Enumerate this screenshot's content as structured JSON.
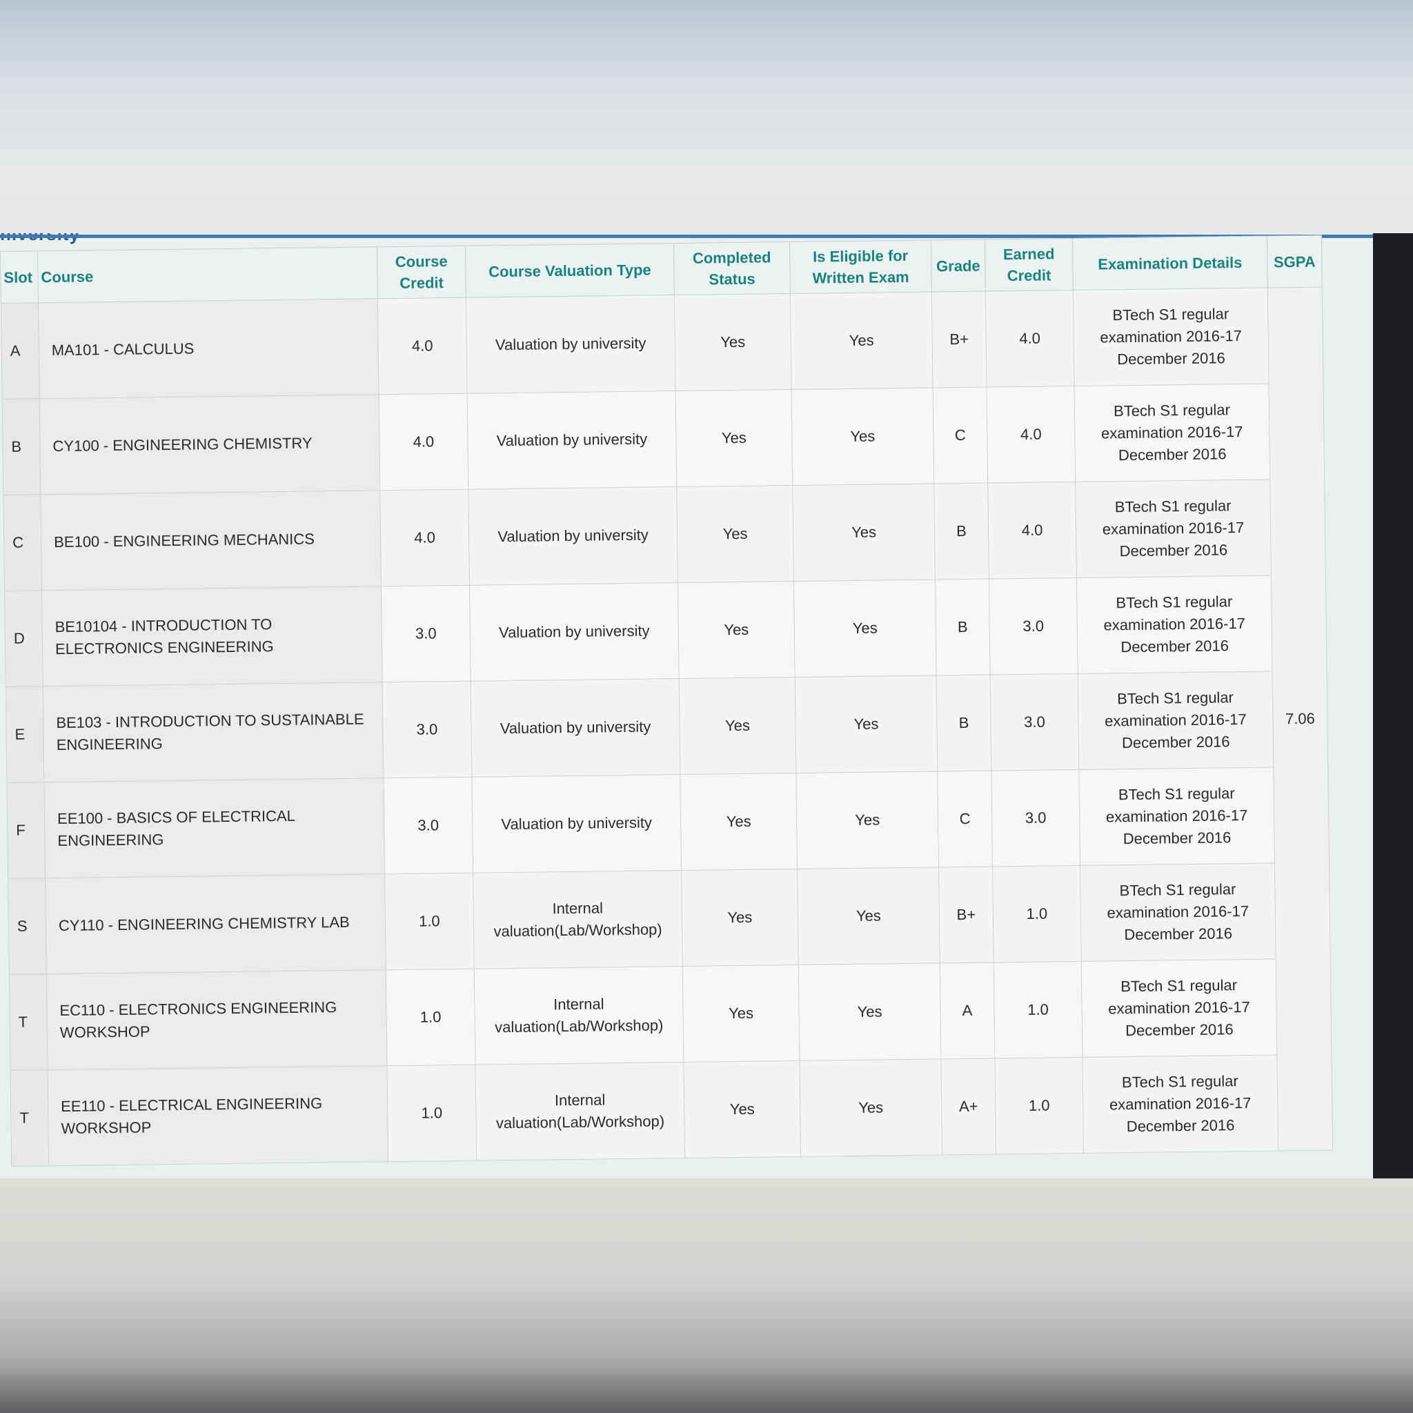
{
  "page": {
    "brand_fragment": "niversity"
  },
  "table": {
    "headers": {
      "slot": "Slot",
      "course": "Course",
      "course_credit": "Course Credit",
      "valuation_type": "Course Valuation Type",
      "completed_status": "Completed Status",
      "eligible": "Is Eligible for Written Exam",
      "grade": "Grade",
      "earned_credit": "Earned Credit",
      "exam_details": "Examination Details",
      "sgpa": "SGPA"
    },
    "rows": [
      {
        "slot": "A",
        "course": "MA101 - CALCULUS",
        "credit": "4.0",
        "valuation": "Valuation by university",
        "completed": "Yes",
        "eligible": "Yes",
        "grade": "B+",
        "earned": "4.0",
        "exam": "BTech S1 regular examination 2016-17 December 2016"
      },
      {
        "slot": "B",
        "course": "CY100 - ENGINEERING CHEMISTRY",
        "credit": "4.0",
        "valuation": "Valuation by university",
        "completed": "Yes",
        "eligible": "Yes",
        "grade": "C",
        "earned": "4.0",
        "exam": "BTech S1 regular examination 2016-17 December 2016"
      },
      {
        "slot": "C",
        "course": "BE100 - ENGINEERING MECHANICS",
        "credit": "4.0",
        "valuation": "Valuation by university",
        "completed": "Yes",
        "eligible": "Yes",
        "grade": "B",
        "earned": "4.0",
        "exam": "BTech S1 regular examination 2016-17 December 2016"
      },
      {
        "slot": "D",
        "course": "BE10104 - INTRODUCTION TO ELECTRONICS ENGINEERING",
        "credit": "3.0",
        "valuation": "Valuation by university",
        "completed": "Yes",
        "eligible": "Yes",
        "grade": "B",
        "earned": "3.0",
        "exam": "BTech S1 regular examination 2016-17 December 2016"
      },
      {
        "slot": "E",
        "course": "BE103 - INTRODUCTION TO SUSTAINABLE ENGINEERING",
        "credit": "3.0",
        "valuation": "Valuation by university",
        "completed": "Yes",
        "eligible": "Yes",
        "grade": "B",
        "earned": "3.0",
        "exam": "BTech S1 regular examination 2016-17 December 2016"
      },
      {
        "slot": "F",
        "course": "EE100 - BASICS OF ELECTRICAL ENGINEERING",
        "credit": "3.0",
        "valuation": "Valuation by university",
        "completed": "Yes",
        "eligible": "Yes",
        "grade": "C",
        "earned": "3.0",
        "exam": "BTech S1 regular examination 2016-17 December 2016"
      },
      {
        "slot": "S",
        "course": "CY110 - ENGINEERING CHEMISTRY LAB",
        "credit": "1.0",
        "valuation": "Internal valuation(Lab/Workshop)",
        "completed": "Yes",
        "eligible": "Yes",
        "grade": "B+",
        "earned": "1.0",
        "exam": "BTech S1 regular examination 2016-17 December 2016"
      },
      {
        "slot": "T",
        "course": "EC110 - ELECTRONICS ENGINEERING WORKSHOP",
        "credit": "1.0",
        "valuation": "Internal valuation(Lab/Workshop)",
        "completed": "Yes",
        "eligible": "Yes",
        "grade": "A",
        "earned": "1.0",
        "exam": "BTech S1 regular examination 2016-17 December 2016"
      },
      {
        "slot": "T",
        "course": "EE110 - ELECTRICAL ENGINEERING WORKSHOP",
        "credit": "1.0",
        "valuation": "Internal valuation(Lab/Workshop)",
        "completed": "Yes",
        "eligible": "Yes",
        "grade": "A+",
        "earned": "1.0",
        "exam": "BTech S1 regular examination 2016-17 December 2016"
      }
    ],
    "sgpa": "7.06"
  }
}
